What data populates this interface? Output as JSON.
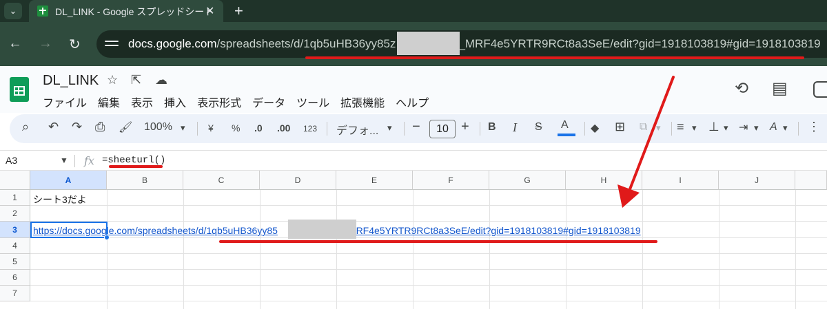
{
  "browser": {
    "tab_title": "DL_LINK - Google スプレッドシート",
    "tab_close": "✕",
    "new_tab": "+",
    "tab_menu": "⌄",
    "back": "←",
    "forward": "→",
    "reload": "↻",
    "url_host": "docs.google.com",
    "url_path_before": "/spreadsheets/d/1qb5uHB36yy85z",
    "url_path_after": "_MRF4e5YRTR9RCt8a3SeE/edit?gid=1918103819#gid=1918103819"
  },
  "header": {
    "title": "DL_LINK",
    "star_icon": "☆",
    "move_icon": "⇱",
    "cloud_icon": "☁",
    "history_icon": "⟲",
    "comment_icon": "▤",
    "menus": [
      "ファイル",
      "編集",
      "表示",
      "挿入",
      "表示形式",
      "データ",
      "ツール",
      "拡張機能",
      "ヘルプ"
    ]
  },
  "toolbar": {
    "search": "⌕",
    "undo": "↶",
    "redo": "↷",
    "print": "⎙",
    "paint_format": "🖌",
    "zoom": "100%",
    "dropdown_caret": "▾",
    "currency": "¥",
    "percent": "%",
    "decrease_decimal": ".0",
    "increase_decimal": ".00",
    "more_formats": "123",
    "font": "デフォ...",
    "minus": "−",
    "font_size": "10",
    "plus": "+",
    "bold": "B",
    "italic": "I",
    "strike": "S",
    "text_color": "A",
    "fill": "◆",
    "borders": "⊞",
    "merge": "⧉",
    "align": "≡",
    "valign": "⊥",
    "wrap": "⇥",
    "rotate": "A",
    "more": "⋮"
  },
  "formula_bar": {
    "cell_ref": "A3",
    "name_caret": "▼",
    "fx": "fx",
    "formula": "=sheeturl()"
  },
  "grid": {
    "columns": [
      "A",
      "B",
      "C",
      "D",
      "E",
      "F",
      "G",
      "H",
      "I",
      "J"
    ],
    "rows": [
      "1",
      "2",
      "3",
      "4",
      "5",
      "6",
      "7"
    ],
    "cells": {
      "A1": "シート3だよ",
      "A3_before": "https://docs.google.com/spreadsheets/d/1qb5uHB36yy85",
      "A3_after": "MRF4e5YRTR9RCt8a3SeE/edit?gid=1918103819#gid=1918103819"
    },
    "selected_cell": "A3"
  },
  "colors": {
    "annotation_red": "#e01a1a",
    "selection_blue": "#1a73e8",
    "link_blue": "#1155cc",
    "sheets_green": "#0f9d58"
  }
}
